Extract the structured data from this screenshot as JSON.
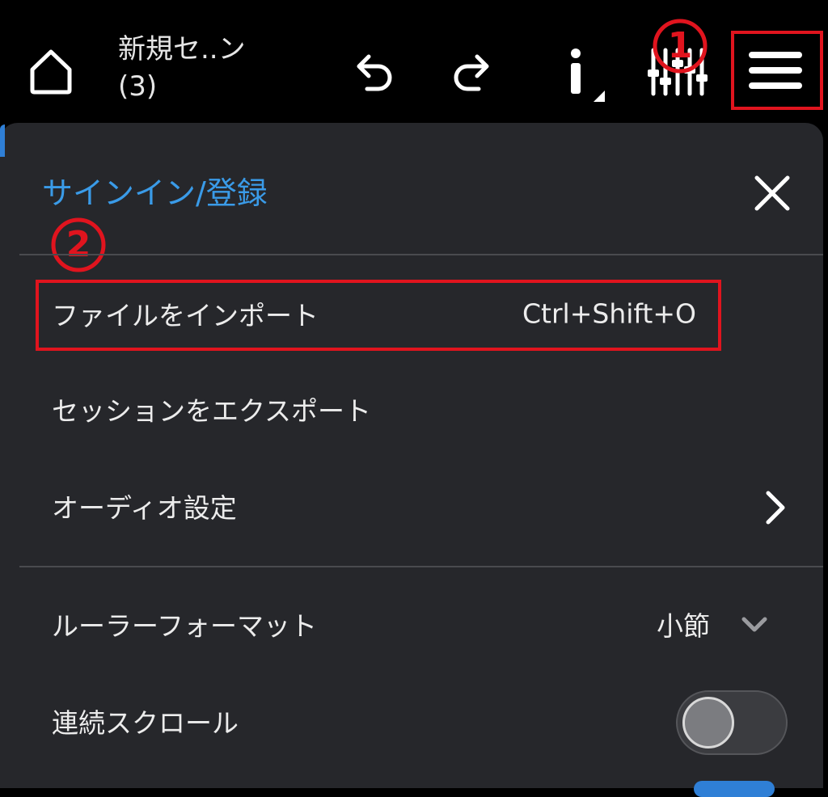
{
  "header": {
    "home_icon": "home-icon",
    "project_title_line1": "新規セ..ン",
    "project_title_line2": "(3)",
    "undo_icon": "undo-icon",
    "redo_icon": "redo-icon",
    "info_icon": "info-icon",
    "mixer_icon": "mixer-icon",
    "menu_icon": "hamburger-menu-icon"
  },
  "annotations": {
    "marker1": "1",
    "marker2": "2",
    "color": "#e0141e"
  },
  "menu": {
    "signin_label": "サインイン/登録",
    "close_icon": "close-icon",
    "items": [
      {
        "label": "ファイルをインポート",
        "shortcut": "Ctrl+Shift+O"
      },
      {
        "label": "セッションをエクスポート"
      },
      {
        "label": "オーディオ設定",
        "icon": "chevron-right-icon"
      },
      {
        "label": "ルーラーフォーマット",
        "value": "小節",
        "icon": "chevron-down-icon"
      },
      {
        "label": "連続スクロール",
        "toggle": "off"
      }
    ]
  },
  "colors": {
    "accent": "#3a9be8",
    "panel_bg": "#26272b",
    "annotation_red": "#e0141e"
  }
}
